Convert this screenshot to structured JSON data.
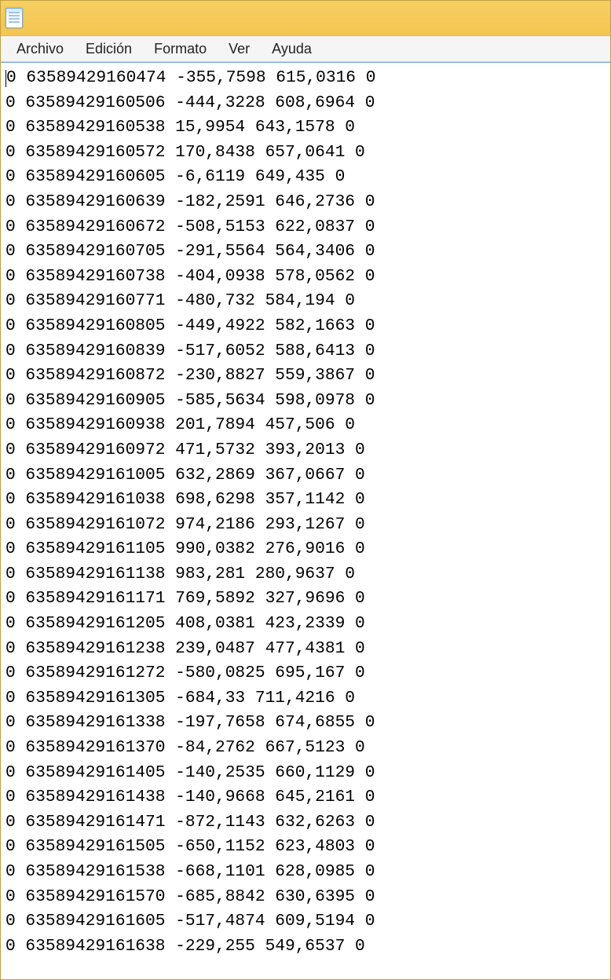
{
  "menu": {
    "archivo": "Archivo",
    "edicion": "Edición",
    "formato": "Formato",
    "ver": "Ver",
    "ayuda": "Ayuda"
  },
  "lines": [
    "0 63589429160474 -355,7598 615,0316 0",
    "0 63589429160506 -444,3228 608,6964 0",
    "0 63589429160538 15,9954 643,1578 0",
    "0 63589429160572 170,8438 657,0641 0",
    "0 63589429160605 -6,6119 649,435 0",
    "0 63589429160639 -182,2591 646,2736 0",
    "0 63589429160672 -508,5153 622,0837 0",
    "0 63589429160705 -291,5564 564,3406 0",
    "0 63589429160738 -404,0938 578,0562 0",
    "0 63589429160771 -480,732 584,194 0",
    "0 63589429160805 -449,4922 582,1663 0",
    "0 63589429160839 -517,6052 588,6413 0",
    "0 63589429160872 -230,8827 559,3867 0",
    "0 63589429160905 -585,5634 598,0978 0",
    "0 63589429160938 201,7894 457,506 0",
    "0 63589429160972 471,5732 393,2013 0",
    "0 63589429161005 632,2869 367,0667 0",
    "0 63589429161038 698,6298 357,1142 0",
    "0 63589429161072 974,2186 293,1267 0",
    "0 63589429161105 990,0382 276,9016 0",
    "0 63589429161138 983,281 280,9637 0",
    "0 63589429161171 769,5892 327,9696 0",
    "0 63589429161205 408,0381 423,2339 0",
    "0 63589429161238 239,0487 477,4381 0",
    "0 63589429161272 -580,0825 695,167 0",
    "0 63589429161305 -684,33 711,4216 0",
    "0 63589429161338 -197,7658 674,6855 0",
    "0 63589429161370 -84,2762 667,5123 0",
    "0 63589429161405 -140,2535 660,1129 0",
    "0 63589429161438 -140,9668 645,2161 0",
    "0 63589429161471 -872,1143 632,6263 0",
    "0 63589429161505 -650,1152 623,4803 0",
    "0 63589429161538 -668,1101 628,0985 0",
    "0 63589429161570 -685,8842 630,6395 0",
    "0 63589429161605 -517,4874 609,5194 0",
    "0 63589429161638 -229,255 549,6537 0"
  ]
}
